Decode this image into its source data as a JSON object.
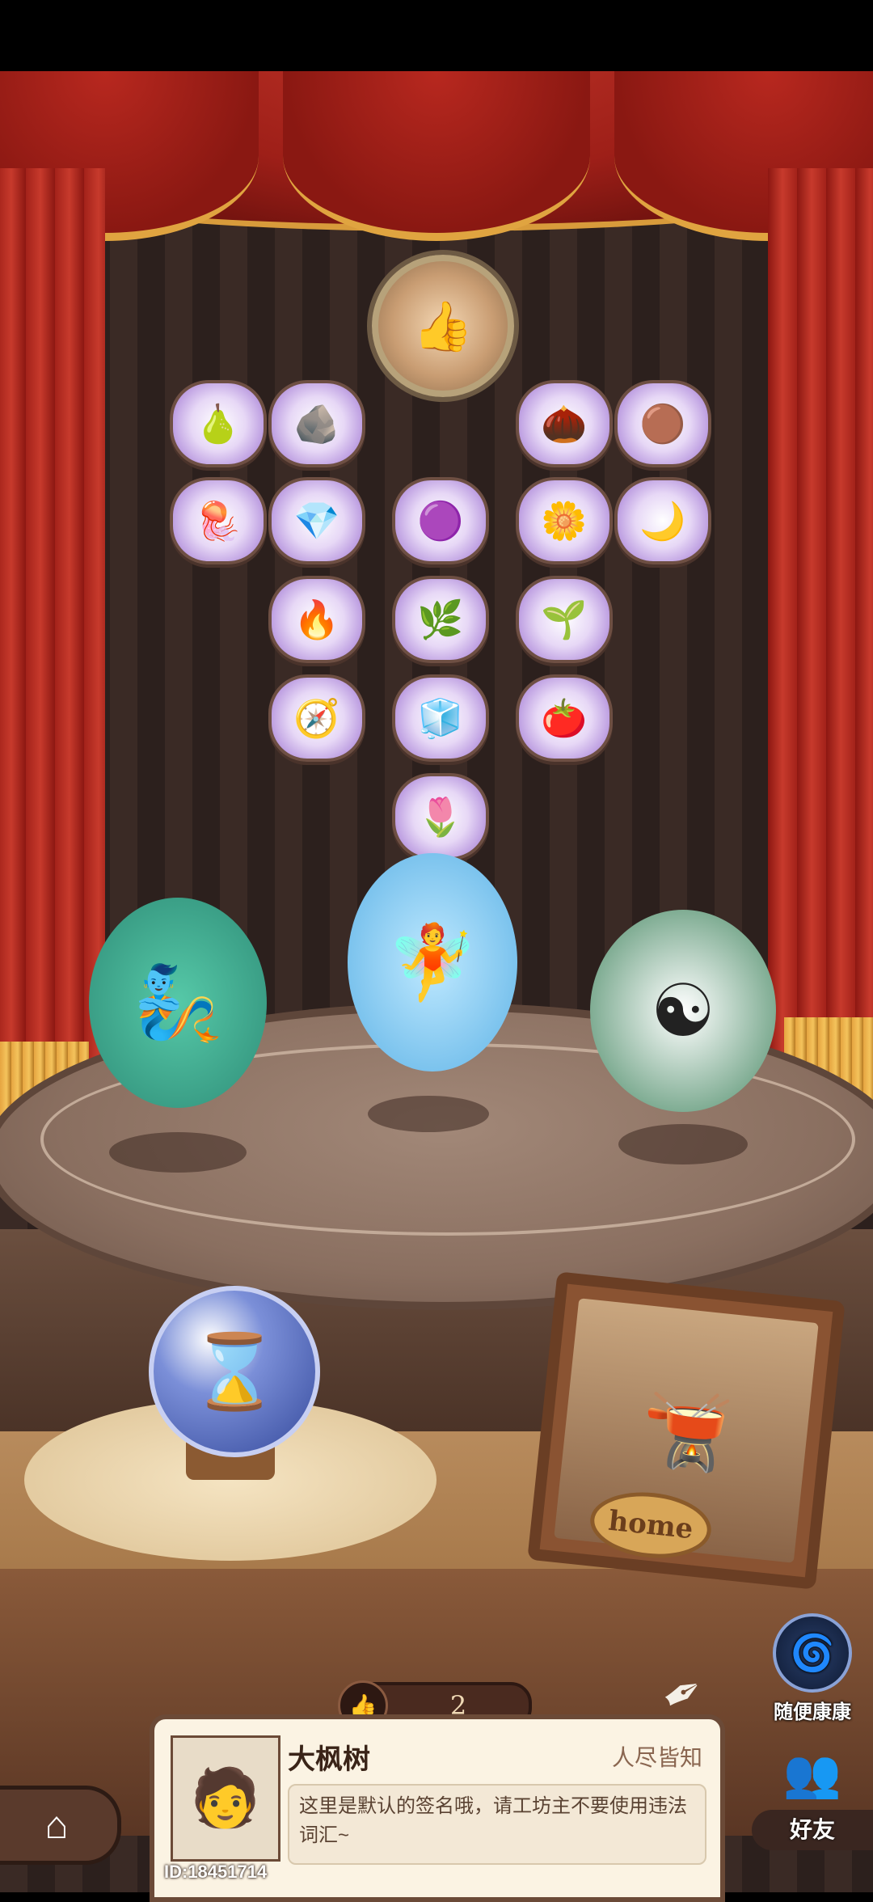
{
  "items": [
    {
      "icon": "🍐",
      "name": "teal-fruit-icon"
    },
    {
      "icon": "🪨",
      "name": "dark-stone-icon"
    },
    {
      "icon": "🌰",
      "name": "nuts-icon"
    },
    {
      "icon": "🟤",
      "name": "mud-icon"
    },
    {
      "icon": "🪼",
      "name": "jellyfish-icon"
    },
    {
      "icon": "💎",
      "name": "crystal-icon"
    },
    {
      "icon": "🟣",
      "name": "purple-coral-icon"
    },
    {
      "icon": "🌼",
      "name": "yellow-flower-icon"
    },
    {
      "icon": "🌙",
      "name": "moon-icon"
    },
    {
      "icon": "🔥",
      "name": "ember-rock-icon"
    },
    {
      "icon": "🌿",
      "name": "bone-branch-icon"
    },
    {
      "icon": "🌱",
      "name": "green-sprout-icon"
    },
    {
      "icon": "🧭",
      "name": "amulet-icon"
    },
    {
      "icon": "🧊",
      "name": "ice-block-icon"
    },
    {
      "icon": "🍅",
      "name": "tomato-icon"
    },
    {
      "icon": "🌷",
      "name": "white-lily-icon"
    }
  ],
  "center_emblem": {
    "icon": "👍"
  },
  "characters": [
    {
      "name": "genie",
      "icon": "🧞"
    },
    {
      "name": "ice-fairy",
      "icon": "🧚"
    },
    {
      "name": "taoist",
      "icon": "☯"
    }
  ],
  "orb": {
    "icon": "⌛"
  },
  "home_frame": {
    "label": "home",
    "icon": "🫕"
  },
  "side_button": {
    "label": "随便康康",
    "icon": "🌀"
  },
  "likes": {
    "count": "2",
    "icon": "👍"
  },
  "profile": {
    "name": "大枫树",
    "title": "人尽皆知",
    "id_text": "ID:18451714",
    "signature": "这里是默认的签名哦，请工坊主不要使用违法词汇~",
    "avatar_icon": "🧑"
  },
  "nav": {
    "home_icon": "⌂",
    "friends_label": "好友",
    "friends_icon": "👥"
  }
}
